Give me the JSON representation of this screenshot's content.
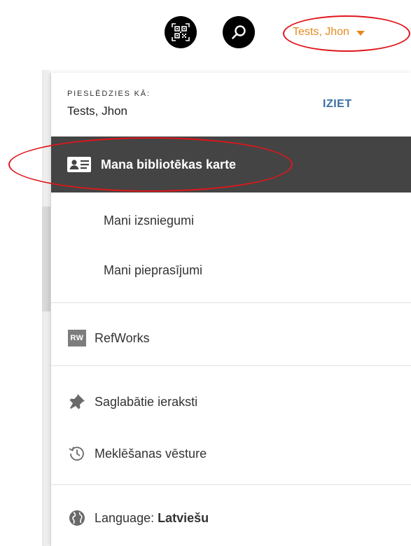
{
  "header": {
    "qr_icon": "qr-code-icon",
    "search_icon": "search-icon",
    "user_name": "Tests, Jhon",
    "accent_color": "#e48a1f"
  },
  "menu": {
    "signed_in_label": "PIESLĒDZIES KĀ:",
    "signed_in_name": "Tests, Jhon",
    "logout_label": "IZIET",
    "library_card": "Mana bibliotēkas karte",
    "loans": "Mani izsniegumi",
    "requests": "Mani pieprasījumi",
    "refworks_badge": "RW",
    "refworks": "RefWorks",
    "saved_records": "Saglabātie ieraksti",
    "search_history": "Meklēšanas vēsture",
    "language_label": "Language:",
    "language_value": "Latviešu"
  },
  "colors": {
    "selected_row": "#444444",
    "logout": "#3a6fa3",
    "highlight_ring": "#e0161b"
  }
}
